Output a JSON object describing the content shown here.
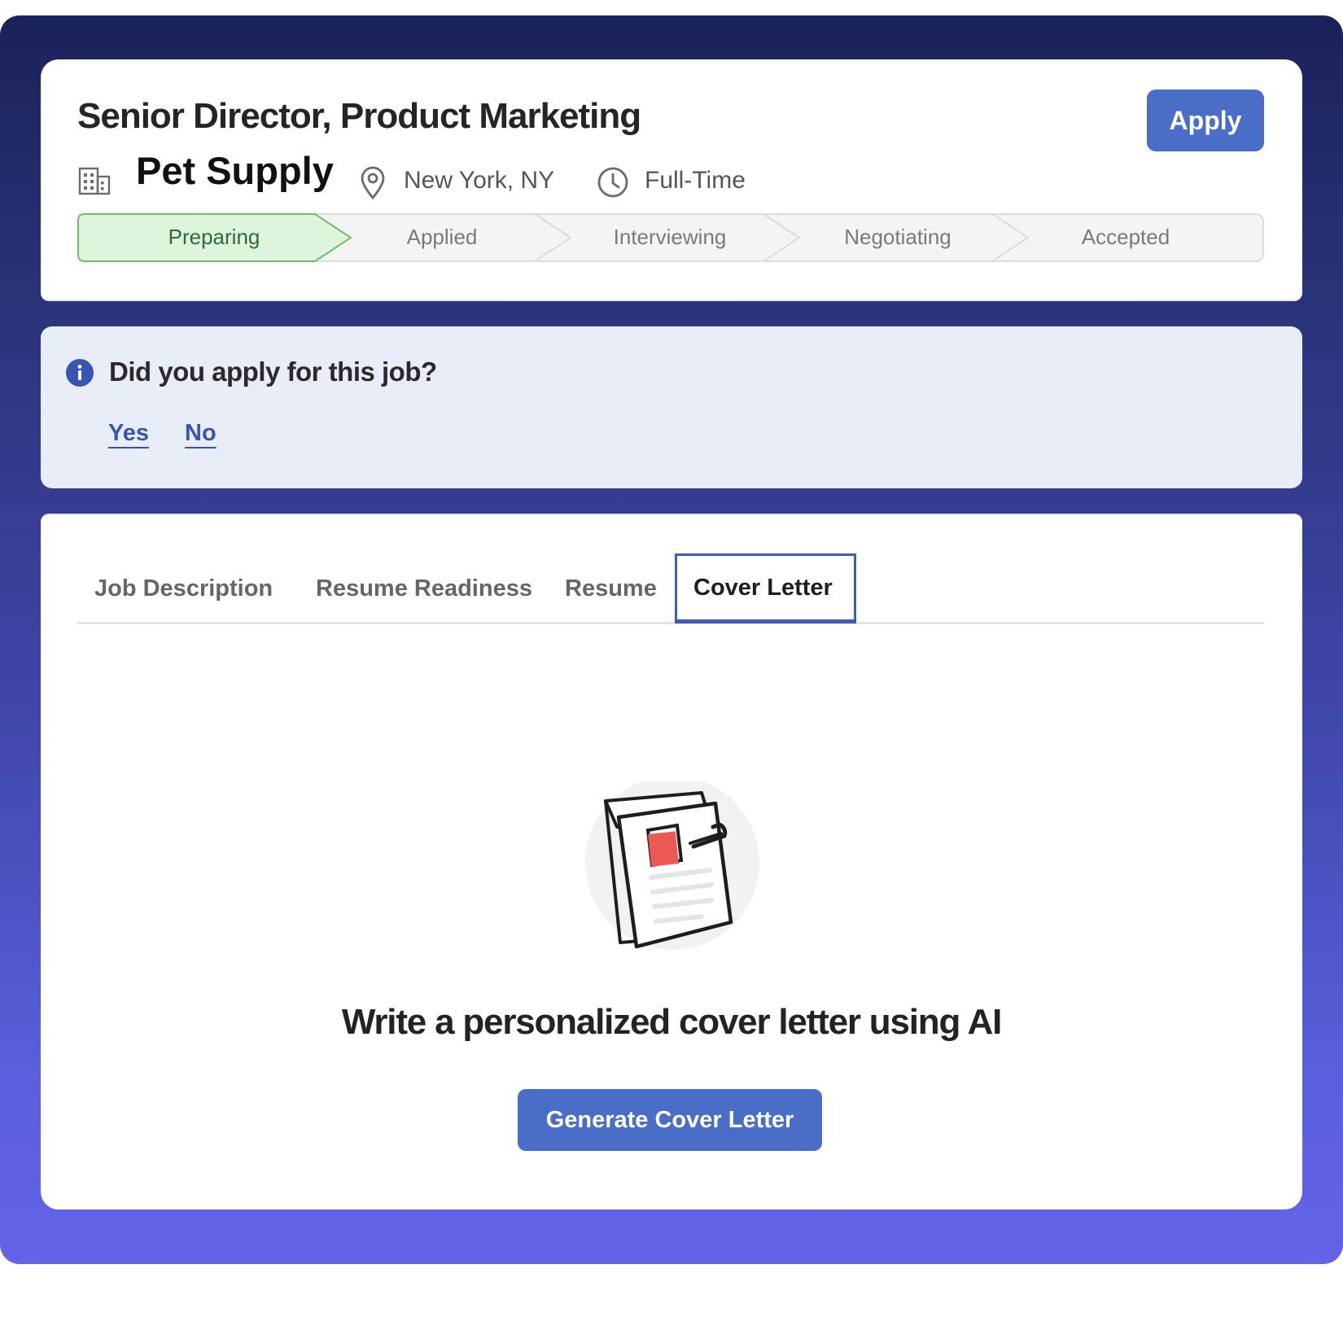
{
  "job": {
    "title": "Senior Director, Product Marketing",
    "company": "Pet Supply",
    "location": "New York, NY",
    "employment_type": "Full-Time",
    "apply_label": "Apply"
  },
  "stepper": {
    "steps": [
      "Preparing",
      "Applied",
      "Interviewing",
      "Negotiating",
      "Accepted"
    ],
    "active_step": "Preparing"
  },
  "alert": {
    "icon": "info-icon",
    "question": "Did you apply for this job?",
    "yes_label": "Yes",
    "no_label": "No"
  },
  "tabs": {
    "items": [
      "Job Description",
      "Resume Readiness",
      "Resume",
      "Cover Letter"
    ],
    "active": "Cover Letter"
  },
  "cover_letter": {
    "illustration": "document-clip-icon",
    "headline": "Write a personalized cover letter using AI",
    "button_label": "Generate Cover Letter"
  },
  "colors": {
    "background_top": "#1b2159",
    "background_bottom": "#6463e8",
    "primary": "#4a6dc8",
    "active_step_fill": "#dcf5dc",
    "active_step_border": "#6cc06c",
    "alert_background": "#e8edf8",
    "link": "#3955b4"
  }
}
